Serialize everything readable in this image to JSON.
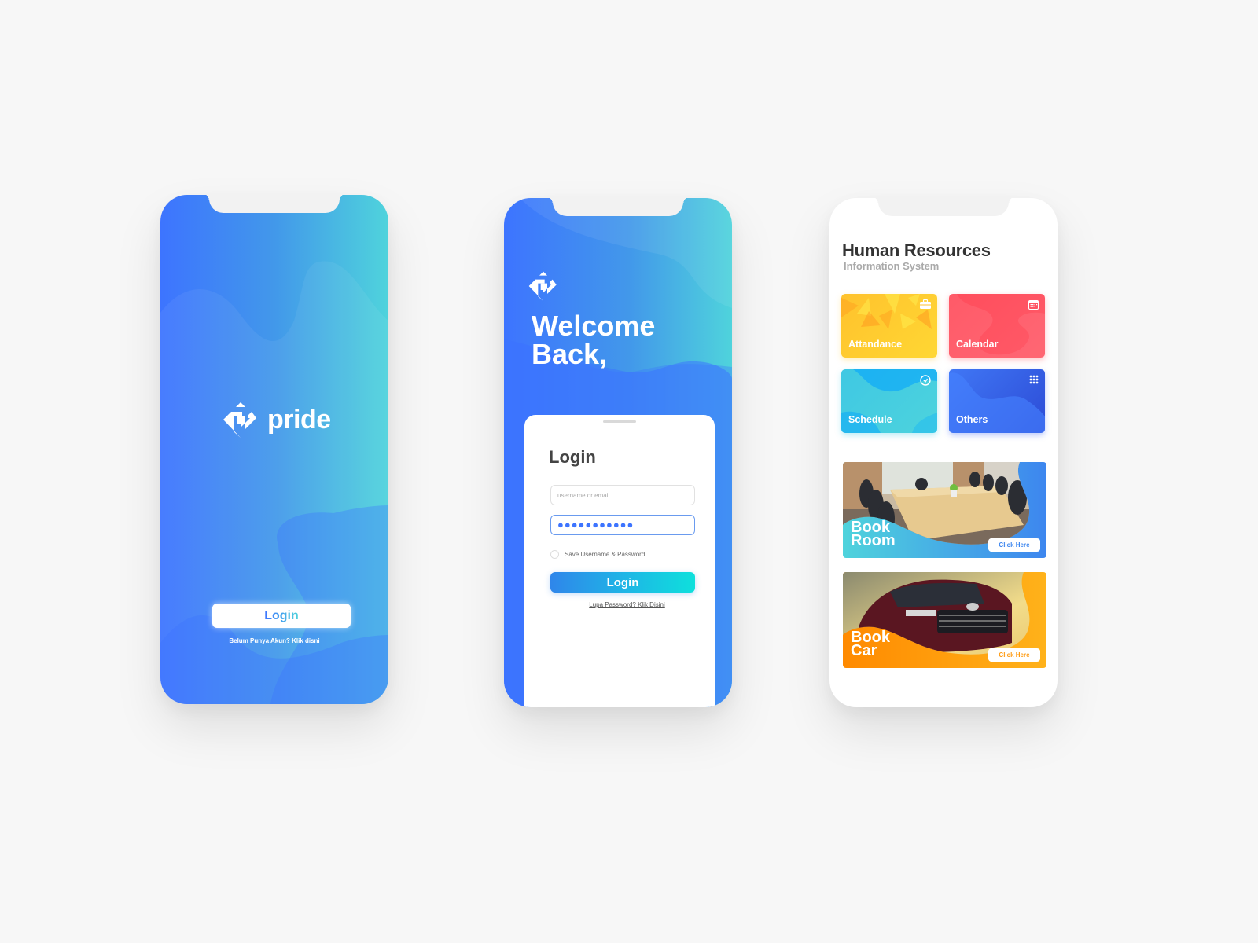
{
  "splash": {
    "brand_name": "pride",
    "logo_icon": "pride-logo-icon",
    "login_button": "Login",
    "signup_link": "Belum Punya Akun? Klik disni",
    "gradient_colors": [
      "#3d74ff",
      "#4fd3dc"
    ]
  },
  "login": {
    "welcome_line1": "Welcome",
    "welcome_line2": "Back,",
    "card_title": "Login",
    "username": {
      "placeholder": "username or email",
      "value": ""
    },
    "password": {
      "value": "●●●●●●●●●●●"
    },
    "save_credentials_label": "Save Username & Password",
    "save_credentials_checked": false,
    "login_button": "Login",
    "forgot_link": "Lupa Password? Klik Disini"
  },
  "dashboard": {
    "title": "Human Resources",
    "subtitle": "Information System",
    "tiles": [
      {
        "label": "Attandance",
        "icon": "briefcase-icon",
        "color": "#ffc22d"
      },
      {
        "label": "Calendar",
        "icon": "calendar-icon",
        "color": "#ff4d5c"
      },
      {
        "label": "Schedule",
        "icon": "clock-icon",
        "color": "#3fc8e3"
      },
      {
        "label": "Others",
        "icon": "grid-icon",
        "color": "#3d6ef0"
      }
    ],
    "banners": [
      {
        "title_line1": "Book",
        "title_line2": "Room",
        "button": "Click Here",
        "accent": "#3d86ef"
      },
      {
        "title_line1": "Book",
        "title_line2": "Car",
        "button": "Click Here",
        "accent": "#ff9a10"
      }
    ]
  }
}
